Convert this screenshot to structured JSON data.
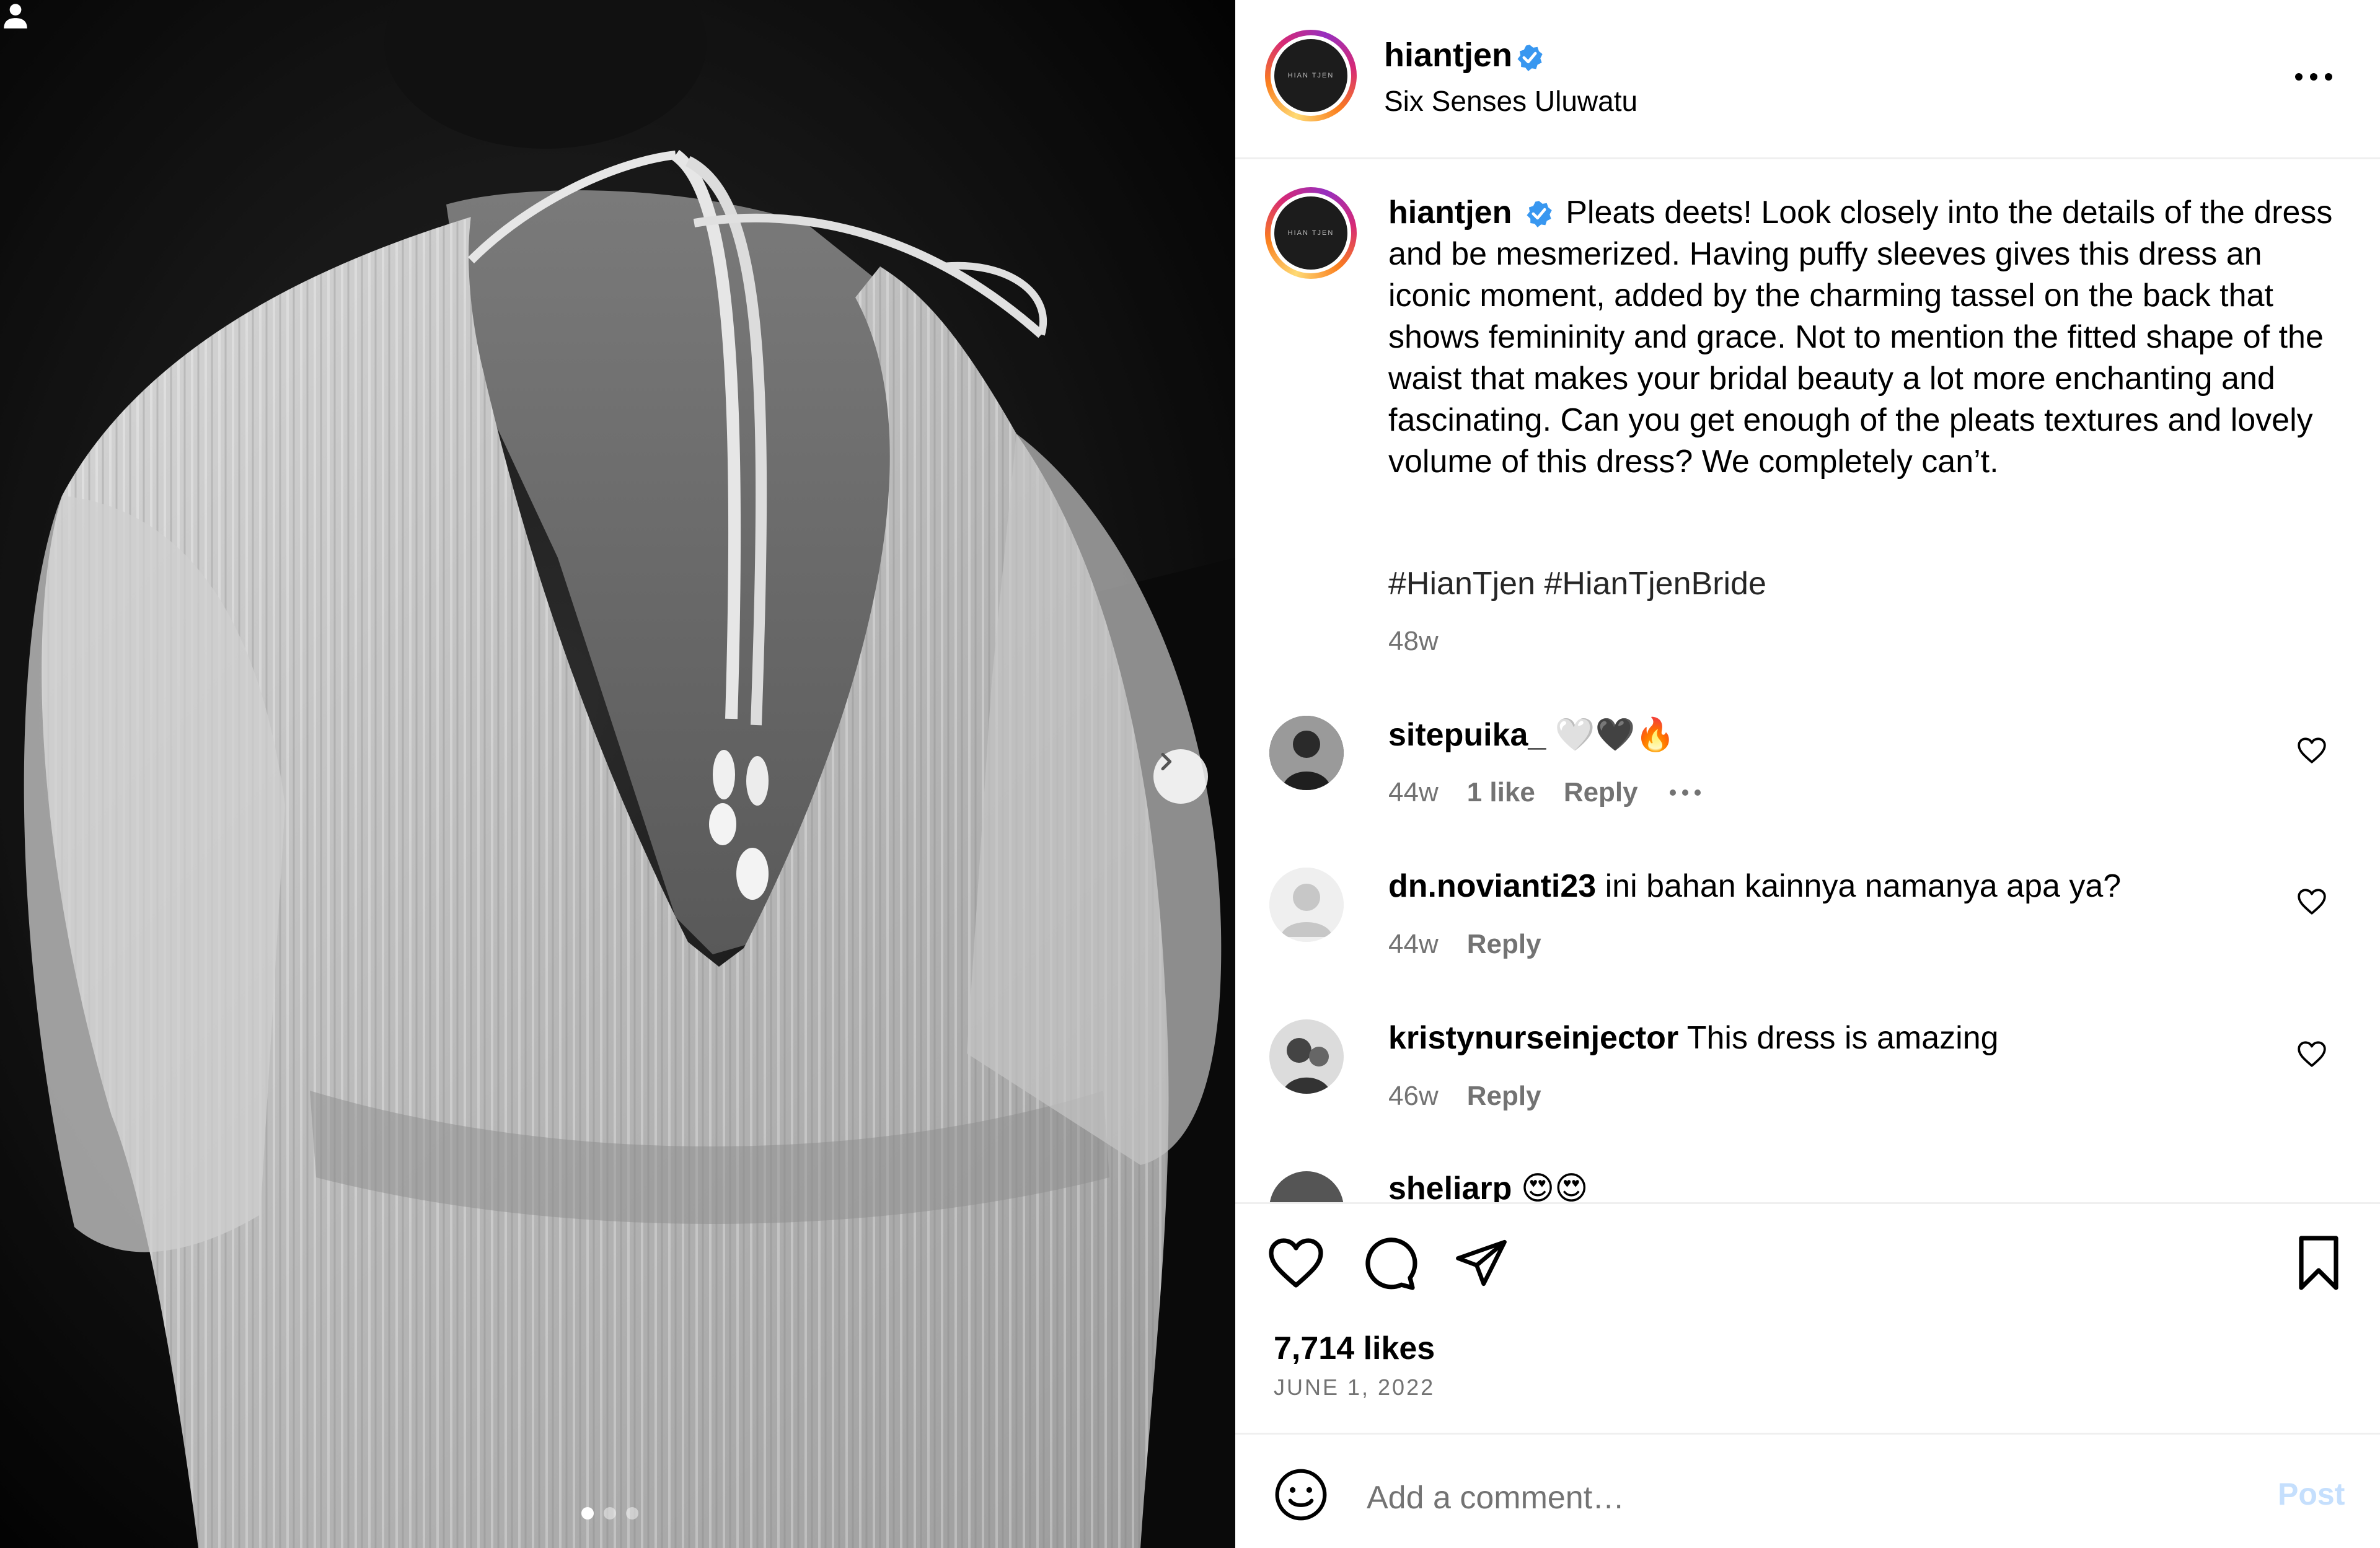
{
  "post": {
    "carousel": {
      "current_index": 1,
      "total": 3
    }
  },
  "header": {
    "username": "hiantjen",
    "location": "Six Senses Uluwatu",
    "avatar_text": "HIAN TJEN"
  },
  "caption": {
    "username": "hiantjen",
    "text": "Pleats deets! Look closely into the details of the dress and be mesmerized. Having puffy sleeves gives this dress an iconic moment, added by the charming tassel on the back that shows femininity and grace. Not to mention the fitted shape of the waist that makes your bridal beauty a lot more enchanting and fascinating. Can you get enough of the pleats textures and lovely volume of this dress? We completely can’t.",
    "hashtags": "#HianTjen #HianTjenBride",
    "time": "48w"
  },
  "comments": [
    {
      "username": "sitepuika_",
      "text": "🤍🖤🔥",
      "time": "44w",
      "likes": "1 like",
      "reply": "Reply"
    },
    {
      "username": "dn.novianti23",
      "text": "ini bahan kainnya namanya apa ya?",
      "time": "44w",
      "reply": "Reply"
    },
    {
      "username": "kristynurseinjector",
      "text": "This dress is amazing",
      "time": "46w",
      "reply": "Reply"
    },
    {
      "username": "sheliarp",
      "text": "😍😍"
    }
  ],
  "footer": {
    "likes": "7,714 likes",
    "date": "JUNE 1, 2022",
    "comment_placeholder": "Add a comment…",
    "post_label": "Post"
  },
  "colors": {
    "verified": "#3897f0",
    "muted": "#737373",
    "post_disabled": "#c5dffd"
  }
}
